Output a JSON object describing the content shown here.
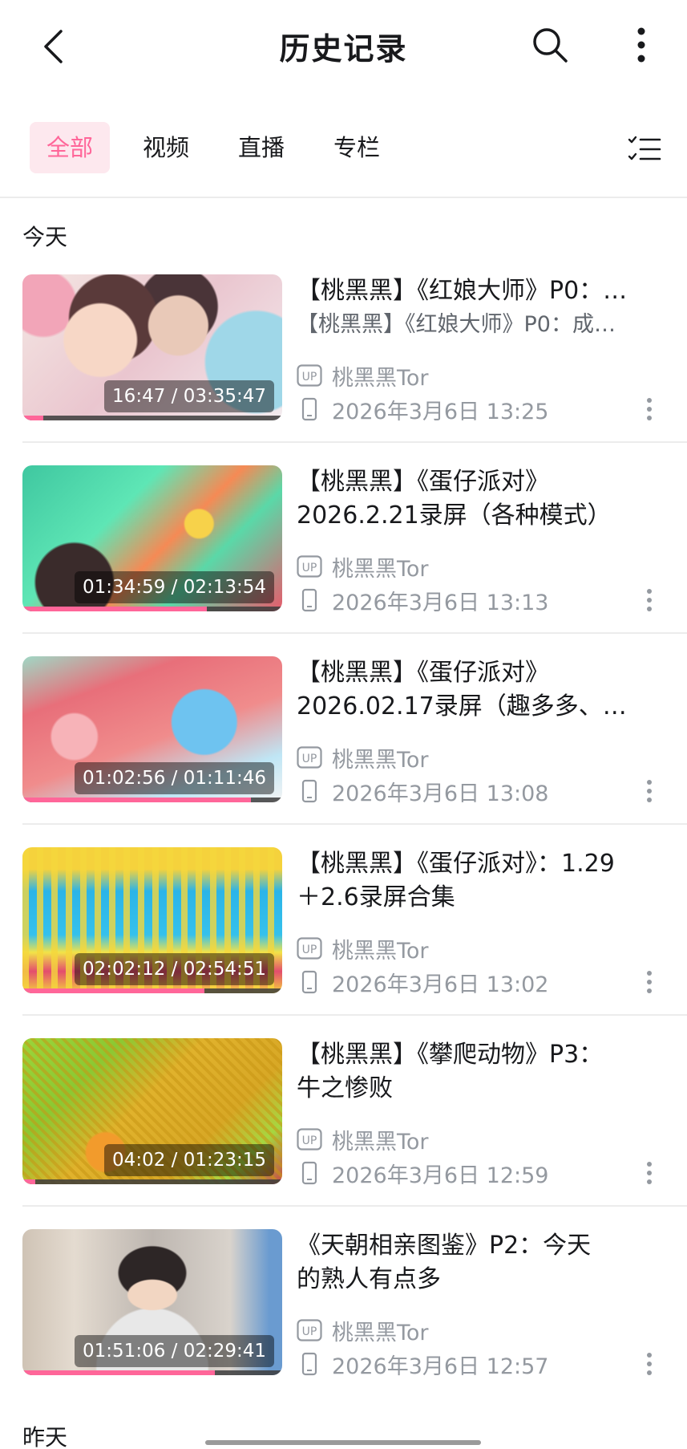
{
  "header": {
    "title": "历史记录"
  },
  "tabs": [
    {
      "label": "全部"
    },
    {
      "label": "视频"
    },
    {
      "label": "直播"
    },
    {
      "label": "专栏"
    }
  ],
  "sections": {
    "today": "今天",
    "yesterday": "昨天"
  },
  "colors": {
    "accent": "#ff6699",
    "meta": "#9499a0"
  },
  "items": [
    {
      "title_line1": "【桃黑黑】《红娘大师》P0：…",
      "subtitle": "【桃黑黑】《红娘大师》P0：成…",
      "uploader": "桃黑黑Tor",
      "watched": "2026年3月6日 13:25",
      "duration": "16:47 / 03:35:47",
      "progress": 0.08
    },
    {
      "title_line1": "【桃黑黑】《蛋仔派对》",
      "title_line2": "2026.2.21录屏（各种模式）",
      "uploader": "桃黑黑Tor",
      "watched": "2026年3月6日 13:13",
      "duration": "01:34:59 / 02:13:54",
      "progress": 0.71
    },
    {
      "title_line1": "【桃黑黑】《蛋仔派对》",
      "title_line2": "2026.02.17录屏（趣多多、…",
      "uploader": "桃黑黑Tor",
      "watched": "2026年3月6日 13:08",
      "duration": "01:02:56 / 01:11:46",
      "progress": 0.88
    },
    {
      "title_line1": "【桃黑黑】《蛋仔派对》：1.29",
      "title_line2": "＋2.6录屏合集",
      "uploader": "桃黑黑Tor",
      "watched": "2026年3月6日 13:02",
      "duration": "02:02:12 / 02:54:51",
      "progress": 0.7
    },
    {
      "title_line1": "【桃黑黑】《攀爬动物》P3：",
      "title_line2": "牛之惨败",
      "uploader": "桃黑黑Tor",
      "watched": "2026年3月6日 12:59",
      "duration": "04:02 / 01:23:15",
      "progress": 0.05
    },
    {
      "title_line1": "《天朝相亲图鉴》P2：今天",
      "title_line2": "的熟人有点多",
      "uploader": "桃黑黑Tor",
      "watched": "2026年3月6日 12:57",
      "duration": "01:51:06 / 02:29:41",
      "progress": 0.74
    }
  ]
}
